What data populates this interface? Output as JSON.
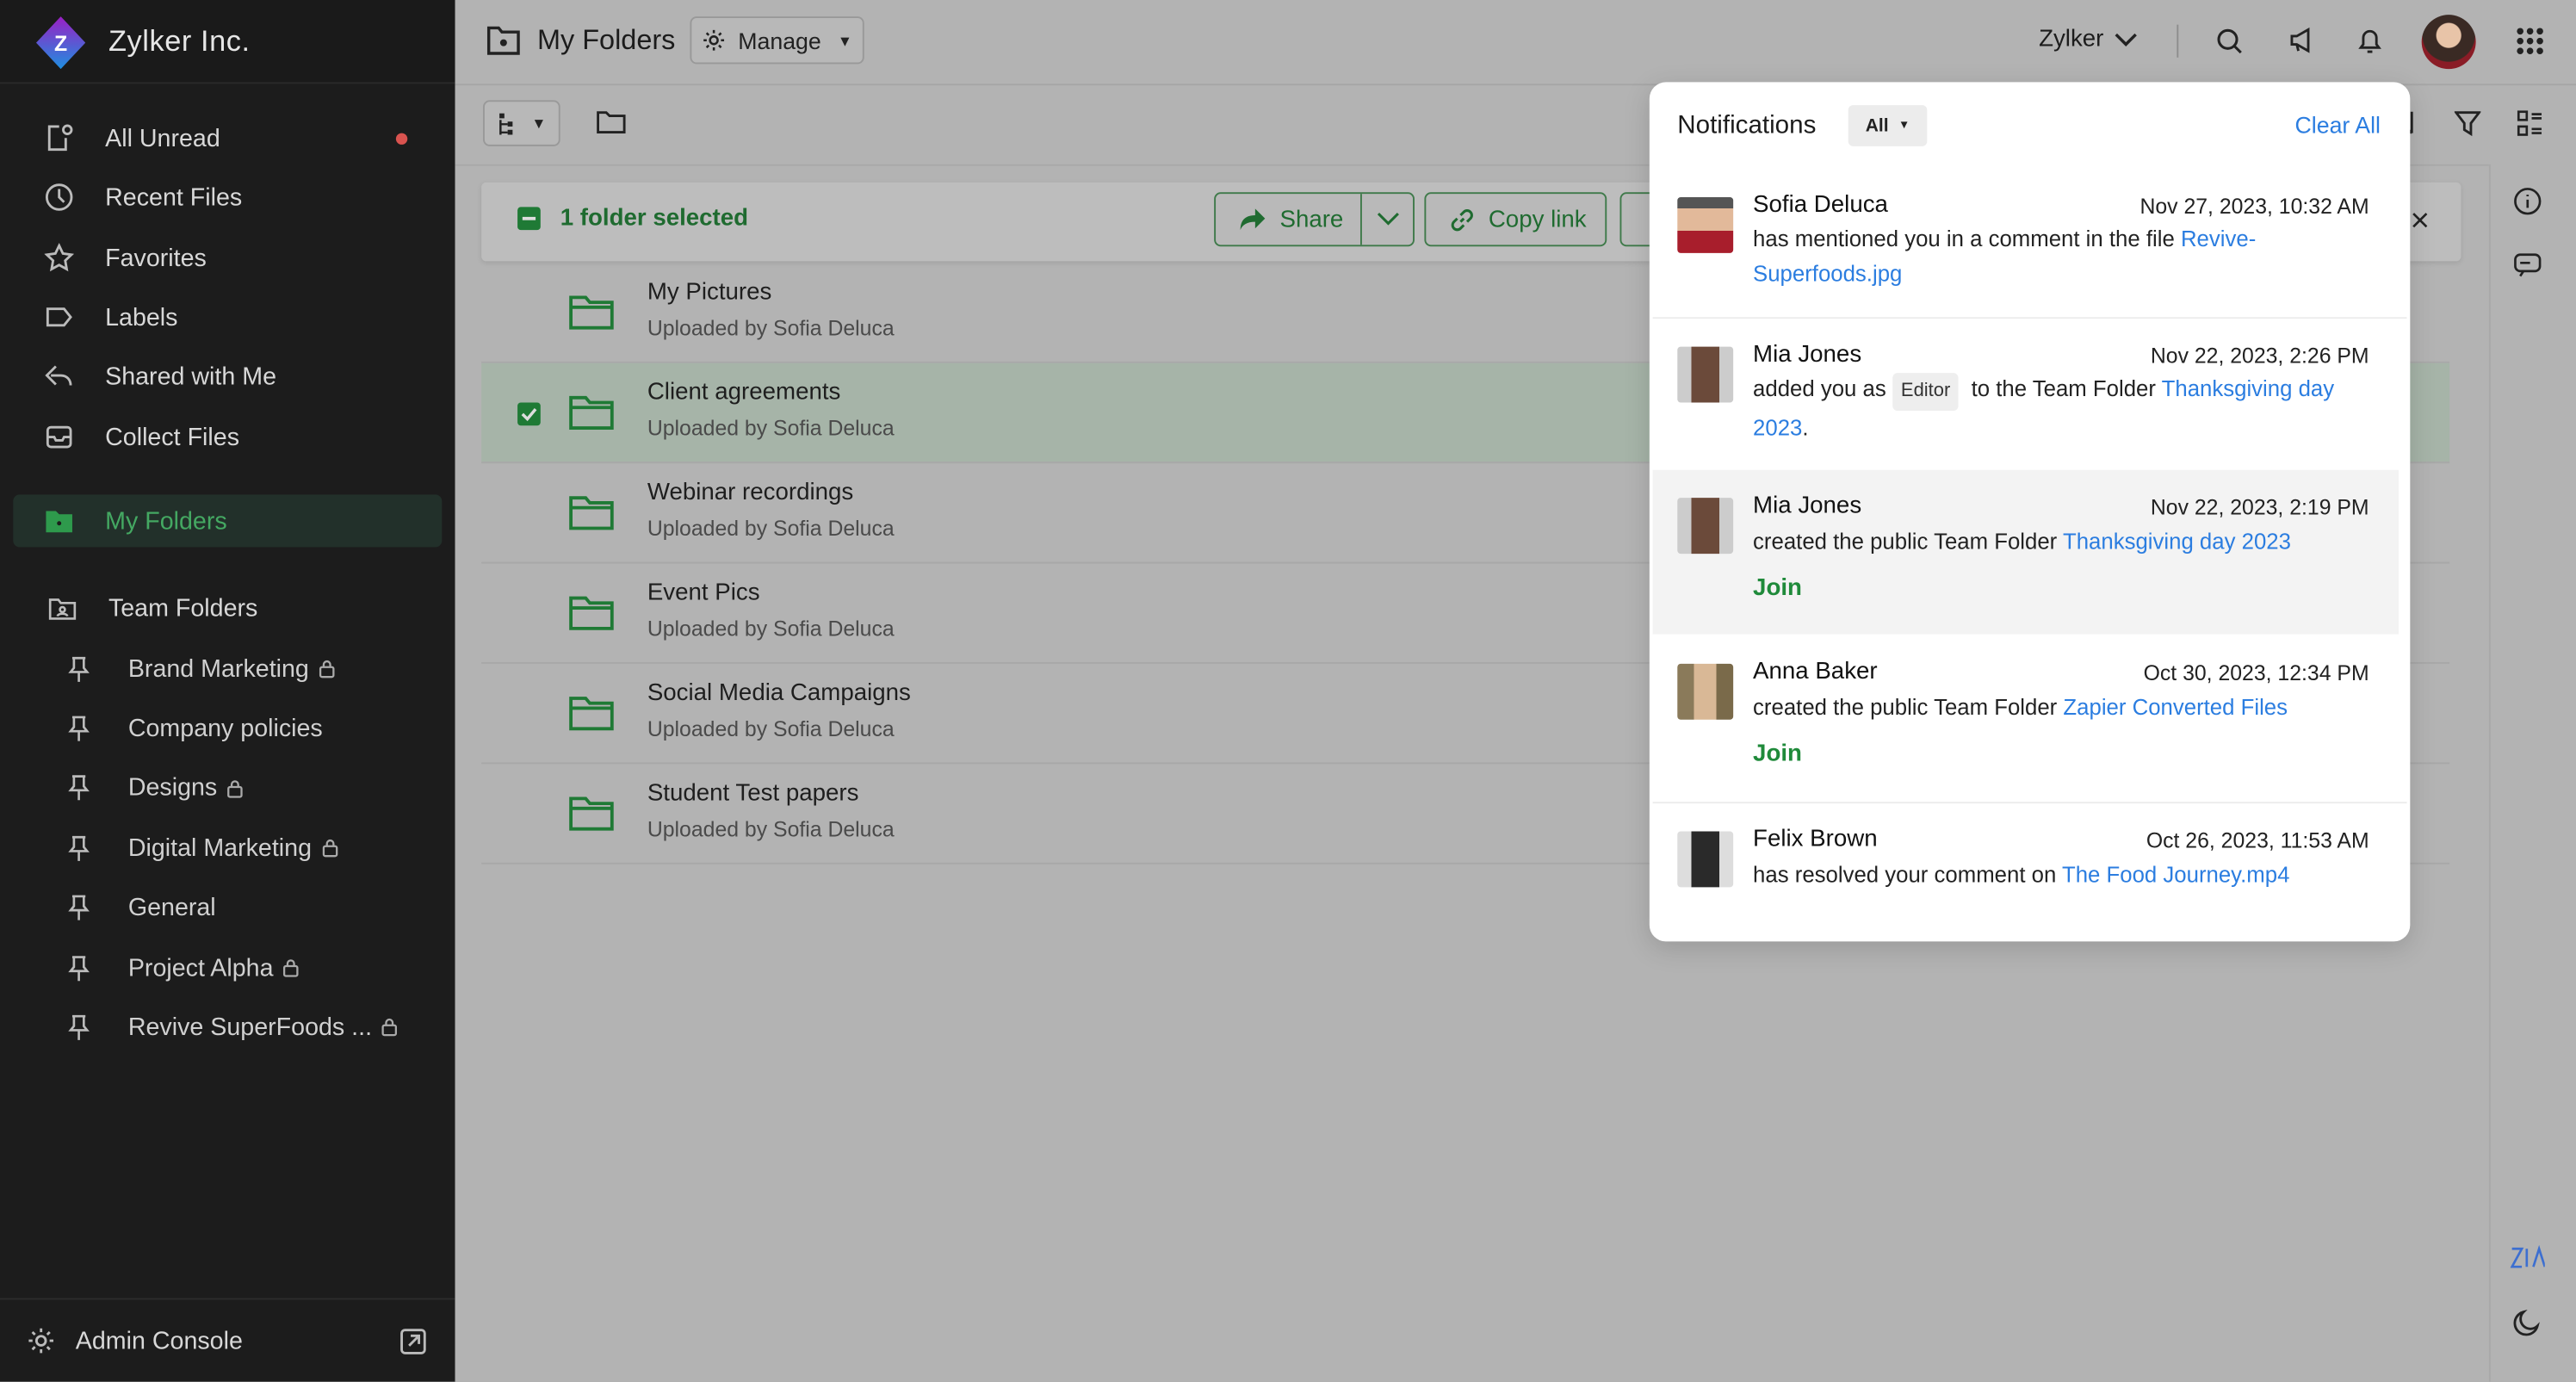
{
  "app": {
    "org_name": "Zylker Inc.",
    "logo_letter": "Z"
  },
  "sidebar": {
    "items": [
      {
        "label": "All Unread",
        "icon": "unread-icon",
        "badge": "dot"
      },
      {
        "label": "Recent Files",
        "icon": "clock-icon"
      },
      {
        "label": "Favorites",
        "icon": "star-icon"
      },
      {
        "label": "Labels",
        "icon": "label-icon"
      },
      {
        "label": "Shared with Me",
        "icon": "share-icon"
      },
      {
        "label": "Collect Files",
        "icon": "inbox-icon"
      }
    ],
    "selected": {
      "label": "My Folders",
      "icon": "folder-icon"
    },
    "team_folders": {
      "label": "Team Folders",
      "items": [
        {
          "label": "Brand Marketing",
          "locked": true
        },
        {
          "label": "Company policies",
          "locked": false
        },
        {
          "label": "Designs",
          "locked": true
        },
        {
          "label": "Digital Marketing",
          "locked": true
        },
        {
          "label": "General",
          "locked": false
        },
        {
          "label": "Project Alpha",
          "locked": true
        },
        {
          "label": "Revive SuperFoods ...",
          "locked": true
        }
      ]
    },
    "admin_console": "Admin Console"
  },
  "header": {
    "title": "My Folders",
    "manage": "Manage",
    "workspace": "Zylker"
  },
  "selection_bar": {
    "text": "1 folder selected",
    "share": "Share",
    "copy_link": "Copy link"
  },
  "folders": [
    {
      "name": "My Pictures",
      "sub": "Uploaded by Sofia Deluca",
      "selected": false
    },
    {
      "name": "Client agreements",
      "sub": "Uploaded by Sofia Deluca",
      "selected": true
    },
    {
      "name": "Webinar recordings",
      "sub": "Uploaded by Sofia Deluca",
      "selected": false
    },
    {
      "name": "Event Pics",
      "sub": "Uploaded by Sofia Deluca",
      "selected": false
    },
    {
      "name": "Social Media Campaigns",
      "sub": "Uploaded by Sofia Deluca",
      "selected": false
    },
    {
      "name": "Student Test papers",
      "sub": "Uploaded by Sofia Deluca",
      "selected": false
    }
  ],
  "notifications": {
    "title": "Notifications",
    "filter": "All",
    "clear_all": "Clear All",
    "items": [
      {
        "name": "Sofia Deluca",
        "date": "Nov 27, 2023, 10:32 AM",
        "text": "has mentioned you in a comment in the file ",
        "link": "Revive-Superfoods.jpg"
      },
      {
        "name": "Mia Jones",
        "date": "Nov 22, 2023, 2:26 PM",
        "text": "added you as",
        "chip": "Editor",
        "text2": "to the Team Folder ",
        "link": "Thanksgiving day 2023",
        "end": "."
      },
      {
        "name": "Mia Jones",
        "date": "Nov 22, 2023, 2:19 PM",
        "text": "created the public Team Folder ",
        "link": "Thanksgiving day 2023",
        "action": "Join"
      },
      {
        "name": "Anna Baker",
        "date": "Oct 30, 2023, 12:34 PM",
        "text": "created the public Team Folder ",
        "link": "Zapier Converted Files",
        "action": "Join"
      },
      {
        "name": "Felix Brown",
        "date": "Oct 26, 2023, 11:53 AM",
        "text": "has resolved your comment on ",
        "link": "The Food Journey.mp4"
      }
    ]
  },
  "colors": {
    "accent_green": "#1f8a3a",
    "link_blue": "#2b7de0",
    "sidebar_bg": "#1c1c1c",
    "unread_dot": "#d9534f"
  }
}
